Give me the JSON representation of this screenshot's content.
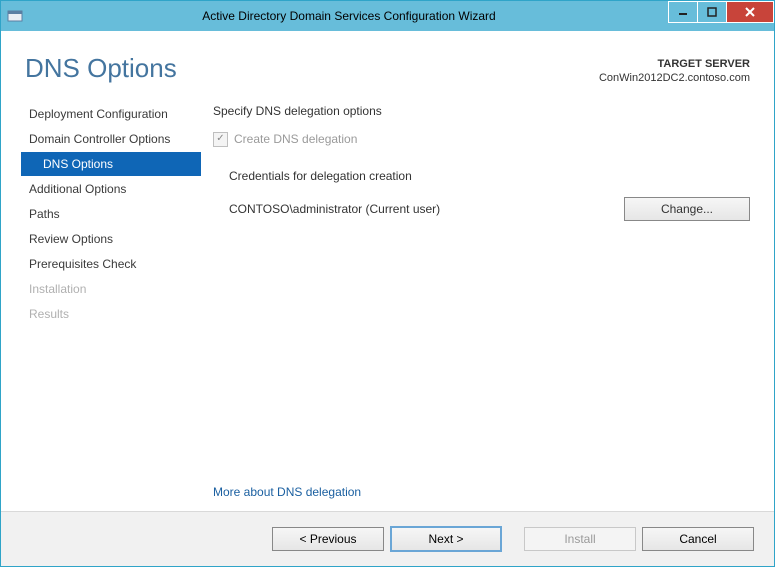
{
  "window": {
    "title": "Active Directory Domain Services Configuration Wizard"
  },
  "header": {
    "page_title": "DNS Options",
    "target_label": "TARGET SERVER",
    "target_value": "ConWin2012DC2.contoso.com"
  },
  "sidebar": {
    "steps": [
      {
        "label": "Deployment Configuration",
        "state": "normal",
        "indent": false
      },
      {
        "label": "Domain Controller Options",
        "state": "normal",
        "indent": false
      },
      {
        "label": "DNS Options",
        "state": "selected",
        "indent": true
      },
      {
        "label": "Additional Options",
        "state": "normal",
        "indent": false
      },
      {
        "label": "Paths",
        "state": "normal",
        "indent": false
      },
      {
        "label": "Review Options",
        "state": "normal",
        "indent": false
      },
      {
        "label": "Prerequisites Check",
        "state": "normal",
        "indent": false
      },
      {
        "label": "Installation",
        "state": "disabled",
        "indent": false
      },
      {
        "label": "Results",
        "state": "disabled",
        "indent": false
      }
    ]
  },
  "main": {
    "section_title": "Specify DNS delegation options",
    "checkbox": {
      "label": "Create DNS delegation",
      "checked": true,
      "enabled": false
    },
    "credentials_header": "Credentials for delegation creation",
    "credentials_value": "CONTOSO\\administrator (Current user)",
    "change_button": "Change...",
    "more_link": "More about DNS delegation"
  },
  "footer": {
    "previous": "< Previous",
    "next": "Next >",
    "install": "Install",
    "cancel": "Cancel"
  }
}
